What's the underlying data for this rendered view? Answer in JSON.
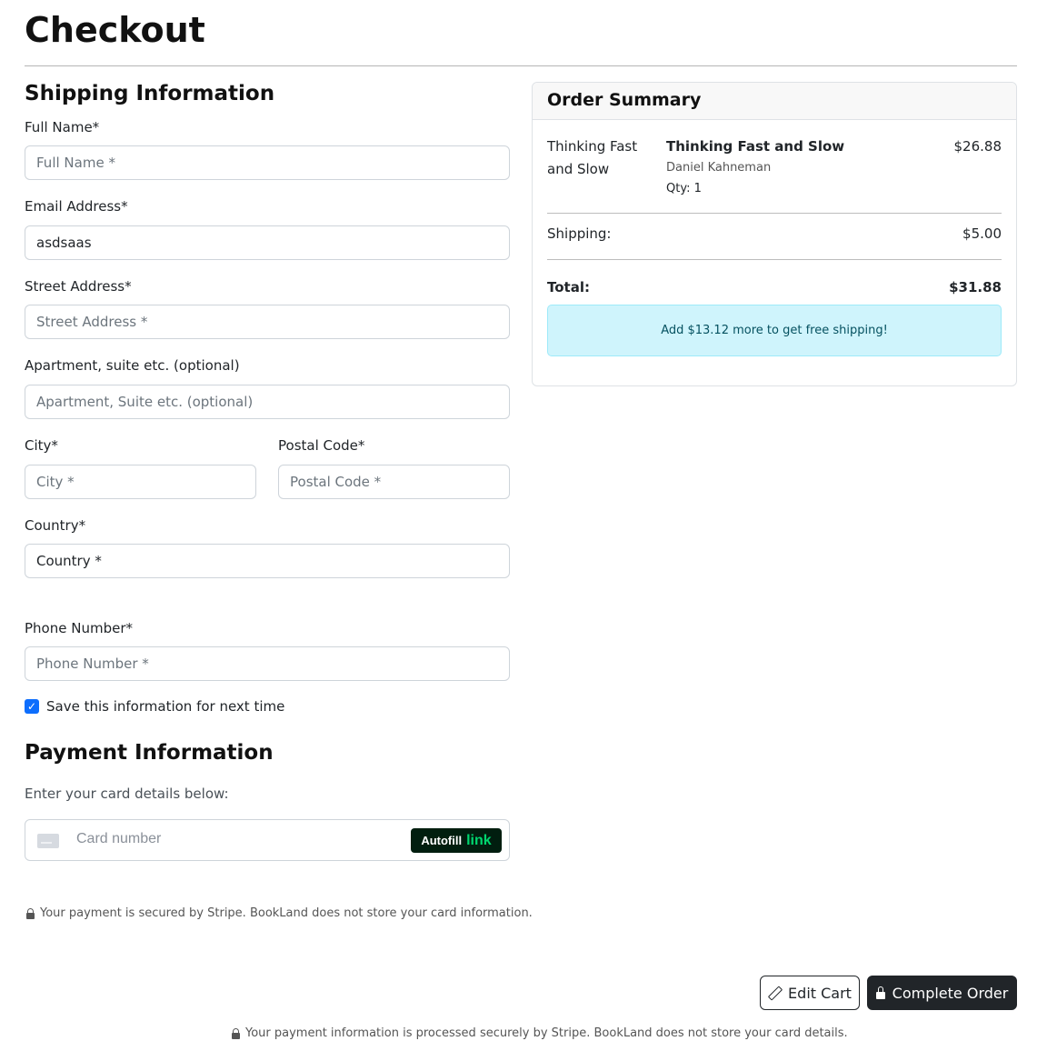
{
  "page": {
    "title": "Checkout"
  },
  "shipping": {
    "heading": "Shipping Information",
    "full_name": {
      "label": "Full Name*",
      "placeholder": "Full Name *",
      "value": ""
    },
    "email": {
      "label": "Email Address*",
      "placeholder": "Email Address *",
      "value": "asdsaas"
    },
    "street": {
      "label": "Street Address*",
      "placeholder": "Street Address *",
      "value": ""
    },
    "apartment": {
      "label": "Apartment, suite etc. (optional)",
      "placeholder": "Apartment, Suite etc. (optional)",
      "value": ""
    },
    "city": {
      "label": "City*",
      "placeholder": "City *",
      "value": ""
    },
    "postal": {
      "label": "Postal Code*",
      "placeholder": "Postal Code *",
      "value": ""
    },
    "country": {
      "label": "Country*",
      "selected": "Country *"
    },
    "phone": {
      "label": "Phone Number*",
      "placeholder": "Phone Number *",
      "value": ""
    },
    "save_info": {
      "label": "Save this information for next time",
      "checked": true
    }
  },
  "payment": {
    "heading": "Payment Information",
    "instructions": "Enter your card details below:",
    "card_placeholder": "Card number",
    "autofill_label": "Autofill",
    "autofill_brand": "link",
    "secure_note": "Your payment is secured by Stripe. BookLand does not store your card information."
  },
  "summary": {
    "heading": "Order Summary",
    "items": [
      {
        "image_alt": "Thinking Fast and Slow",
        "title": "Thinking Fast and Slow",
        "author": "Daniel Kahneman",
        "qty": "Qty: 1",
        "price": "$26.88"
      }
    ],
    "shipping_label": "Shipping:",
    "shipping_value": "$5.00",
    "total_label": "Total:",
    "total_value": "$31.88",
    "promo": "Add $13.12 more to get free shipping!"
  },
  "actions": {
    "edit_cart": "Edit Cart",
    "complete_order": "Complete Order"
  },
  "footer": {
    "note": "Your payment information is processed securely by Stripe. BookLand does not store your card details."
  },
  "colors": {
    "primary": "#0d6efd",
    "dark_button": "#212529",
    "info_bg": "#cff4fc",
    "link_green": "#00d66f"
  }
}
